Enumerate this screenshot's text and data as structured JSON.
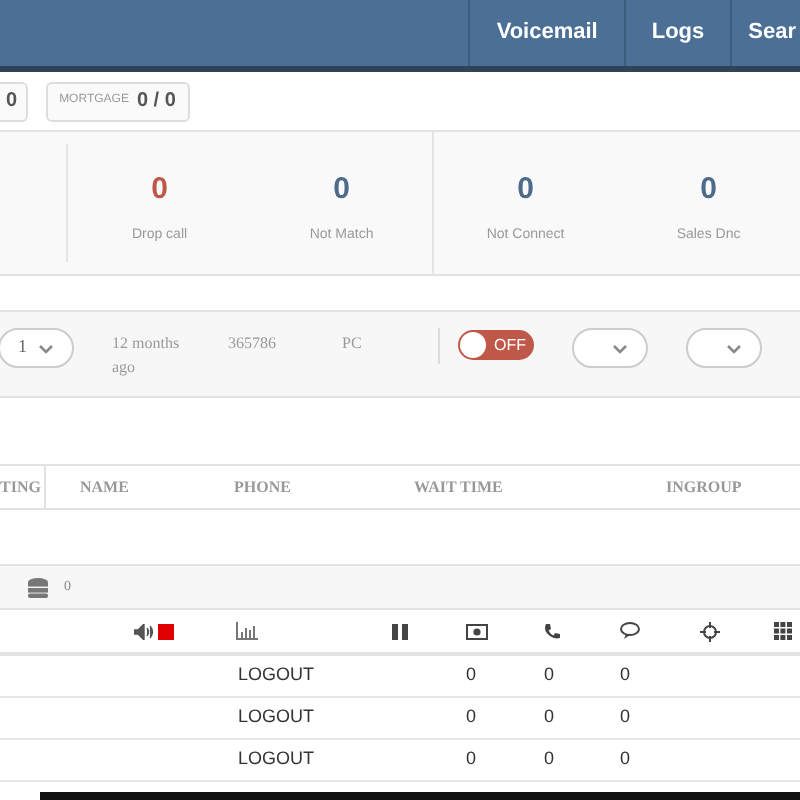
{
  "nav": [
    "Voicemail",
    "Logs",
    "Sear"
  ],
  "badges": [
    {
      "value": "0"
    },
    {
      "label": "MORTGAGE",
      "value": "0 / 0"
    }
  ],
  "stats": [
    {
      "value": "0",
      "label": "Drop call",
      "kind": "alert"
    },
    {
      "value": "0",
      "label": "Not Match",
      "kind": "normal"
    },
    {
      "value": "0",
      "label": "Not Connect",
      "kind": "normal"
    },
    {
      "value": "0",
      "label": "Sales Dnc",
      "kind": "normal"
    }
  ],
  "agent_row": {
    "select_value": "1",
    "time": "12 months ago",
    "id": "365786",
    "type": "PC",
    "toggle": {
      "on": false,
      "label": "OFF"
    }
  },
  "queue_columns": [
    "TING",
    "NAME",
    "PHONE",
    "WAIT TIME",
    "INGROUP"
  ],
  "queue_count": "0",
  "agents_rows": [
    {
      "status": "LOGOUT",
      "c1": "0",
      "c2": "0",
      "c3": "0"
    },
    {
      "status": "LOGOUT",
      "c1": "0",
      "c2": "0",
      "c3": "0"
    },
    {
      "status": "LOGOUT",
      "c1": "0",
      "c2": "0",
      "c3": "0"
    }
  ]
}
